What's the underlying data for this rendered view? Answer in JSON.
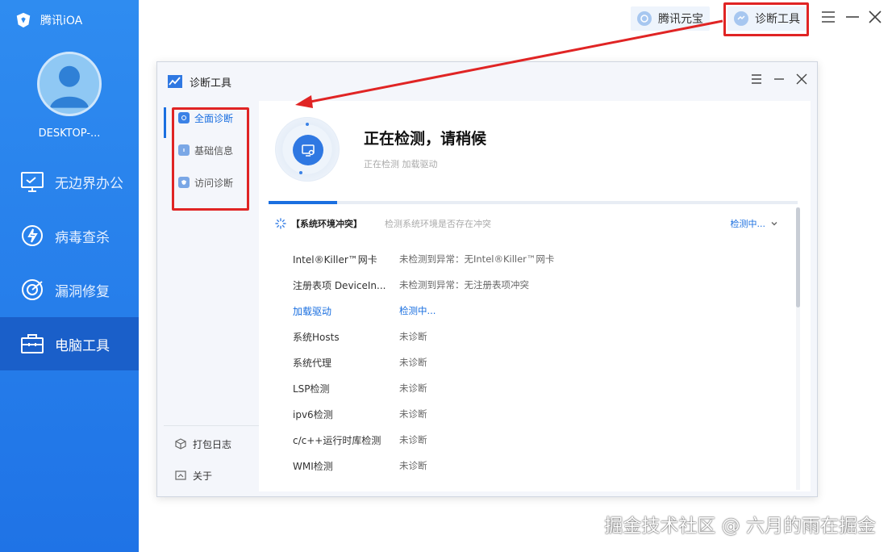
{
  "app": {
    "brand": "腾讯iOA",
    "device_name": "DESKTOP-..."
  },
  "nav": [
    {
      "label": "无边界办公",
      "icon": "monitor-icon"
    },
    {
      "label": "病毒查杀",
      "icon": "lightning-shield-icon"
    },
    {
      "label": "漏洞修复",
      "icon": "target-icon"
    },
    {
      "label": "电脑工具",
      "icon": "toolbox-icon",
      "active": true
    }
  ],
  "topbar": {
    "yuanbao_label": "腾讯元宝",
    "diag_label": "诊断工具"
  },
  "dialog": {
    "title": "诊断工具",
    "sidebar": [
      {
        "label": "全面诊断",
        "active": true
      },
      {
        "label": "基础信息"
      },
      {
        "label": "访问诊断"
      }
    ],
    "sidebar_bottom": [
      {
        "label": "打包日志",
        "icon": "package-icon"
      },
      {
        "label": "关于",
        "icon": "info-box-icon"
      }
    ],
    "status_title": "正在检测，请稍候",
    "status_sub": "正在检测 加载驱动",
    "progress": 0.13,
    "section": {
      "title": "【系统环境冲突】",
      "desc": "检测系统环境是否存在冲突",
      "status": "检测中..."
    },
    "rows": [
      {
        "name": "Intel®Killer™网卡",
        "result": "未检测到异常：无Intel®Killer™网卡"
      },
      {
        "name": "注册表项 DeviceIn...",
        "result": "未检测到异常：无注册表项冲突"
      },
      {
        "name": "加载驱动",
        "result": "检测中...",
        "active": true
      },
      {
        "name": "系统Hosts",
        "result": "未诊断"
      },
      {
        "name": "系统代理",
        "result": "未诊断"
      },
      {
        "name": "LSP检测",
        "result": "未诊断"
      },
      {
        "name": "ipv6检测",
        "result": "未诊断"
      },
      {
        "name": "c/c++运行时库检测",
        "result": "未诊断"
      },
      {
        "name": "WMI检测",
        "result": "未诊断"
      }
    ]
  },
  "watermark": "掘金技术社区 @ 六月的雨在掘金",
  "colors": {
    "sidebar": "#2f8cf0",
    "accent": "#1a6fe0",
    "highlight": "#e02424"
  }
}
